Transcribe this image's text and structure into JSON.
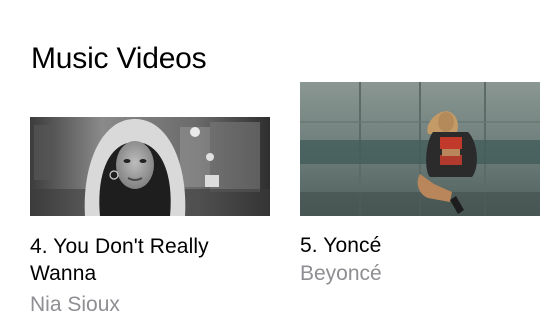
{
  "section": {
    "title": "Music Videos"
  },
  "videos": [
    {
      "title": "4. You Don't Really Wanna",
      "artist": "Nia Sioux",
      "thumbnail_icon": "video-thumbnail-grayscale-portrait"
    },
    {
      "title": "5. Yoncé",
      "artist": "Beyoncé",
      "thumbnail_icon": "video-thumbnail-teal-wall"
    }
  ],
  "colors": {
    "title_text": "#000000",
    "artist_text": "#8e8e93",
    "background": "#ffffff"
  }
}
